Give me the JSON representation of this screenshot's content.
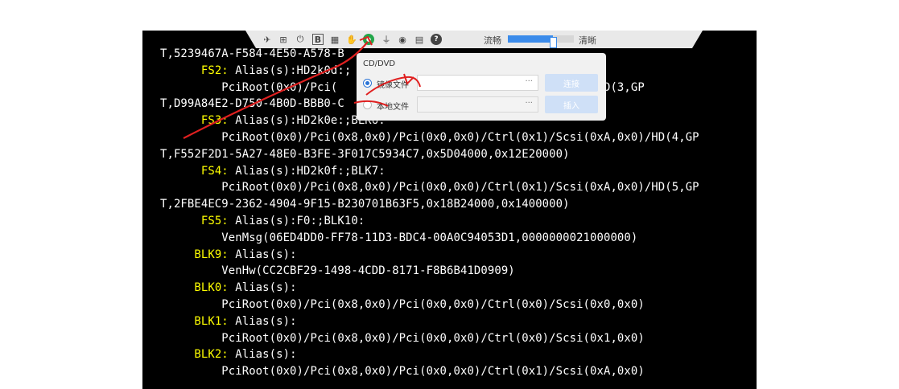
{
  "console": {
    "lines": [
      {
        "text": "T,5239467A-F584-4E50-A578-B",
        "hl": ""
      },
      {
        "indent": "      ",
        "hl": "FS2:",
        "text": " Alias(s):HD2k0d:;"
      },
      {
        "indent": "         ",
        "hl": "",
        "text": "PciRoot(0x0)/Pci(                          si(0xA,0x0)/HD(3,GP"
      },
      {
        "text": "T,D99A84E2-D750-4B0D-BBB0-C",
        "hl": ""
      },
      {
        "indent": "      ",
        "hl": "FS3:",
        "text": " Alias(s):HD2k0e:;BLK6:"
      },
      {
        "indent": "         ",
        "hl": "",
        "text": "PciRoot(0x0)/Pci(0x8,0x0)/Pci(0x0,0x0)/Ctrl(0x1)/Scsi(0xA,0x0)/HD(4,GP"
      },
      {
        "text": "T,F552F2D1-5A27-48E0-B3FE-3F017C5934C7,0x5D04000,0x12E20000)",
        "hl": ""
      },
      {
        "indent": "      ",
        "hl": "FS4:",
        "text": " Alias(s):HD2k0f:;BLK7:"
      },
      {
        "indent": "         ",
        "hl": "",
        "text": "PciRoot(0x0)/Pci(0x8,0x0)/Pci(0x0,0x0)/Ctrl(0x1)/Scsi(0xA,0x0)/HD(5,GP"
      },
      {
        "text": "T,2FBE4EC9-2362-4904-9F15-B230701B63F5,0x18B24000,0x1400000)",
        "hl": ""
      },
      {
        "indent": "      ",
        "hl": "FS5:",
        "text": " Alias(s):F0:;BLK10:"
      },
      {
        "indent": "         ",
        "hl": "",
        "text": "VenMsg(06ED4DD0-FF78-11D3-BDC4-00A0C94053D1,0000000021000000)"
      },
      {
        "indent": "     ",
        "hl": "BLK9:",
        "text": " Alias(s):"
      },
      {
        "indent": "         ",
        "hl": "",
        "text": "VenHw(CC2CBF29-1498-4CDD-8171-F8B6B41D0909)"
      },
      {
        "indent": "     ",
        "hl": "BLK0:",
        "text": " Alias(s):"
      },
      {
        "indent": "         ",
        "hl": "",
        "text": "PciRoot(0x0)/Pci(0x8,0x0)/Pci(0x0,0x0)/Ctrl(0x0)/Scsi(0x0,0x0)"
      },
      {
        "indent": "     ",
        "hl": "BLK1:",
        "text": " Alias(s):"
      },
      {
        "indent": "         ",
        "hl": "",
        "text": "PciRoot(0x0)/Pci(0x8,0x0)/Pci(0x0,0x0)/Ctrl(0x0)/Scsi(0x1,0x0)"
      },
      {
        "indent": "     ",
        "hl": "BLK2:",
        "text": " Alias(s):"
      },
      {
        "indent": "         ",
        "hl": "",
        "text": "PciRoot(0x0)/Pci(0x8,0x0)/Pci(0x0,0x0)/Ctrl(0x1)/Scsi(0xA,0x0)"
      }
    ]
  },
  "toolbar": {
    "icons": [
      "pin-icon",
      "fullscreen-icon",
      "power-icon",
      "b-icon",
      "screenshot-icon",
      "hand-icon",
      "cdrom-icon",
      "usb-icon",
      "record-icon",
      "keyboard-icon",
      "help-icon"
    ],
    "icon_glyphs": [
      "✈",
      "⊞",
      "⏻",
      "B",
      "▦",
      "✋",
      "●",
      "⏚",
      "◉",
      "▤",
      "?"
    ],
    "speed_label": "流畅",
    "clarity_label": "清晰",
    "quality_fraction": 0.68
  },
  "popup": {
    "title": "CD/DVD",
    "image_label": "镜像文件",
    "local_label": "本地文件",
    "image_dots": "···",
    "local_dots": "···",
    "connect_label": "连接",
    "insert_label": "插入"
  },
  "colors": {
    "console_bg": "#000000",
    "console_text": "#ffffff",
    "highlight": "#ffff00",
    "accent": "#2b74d6",
    "annotation": "#e02020"
  }
}
